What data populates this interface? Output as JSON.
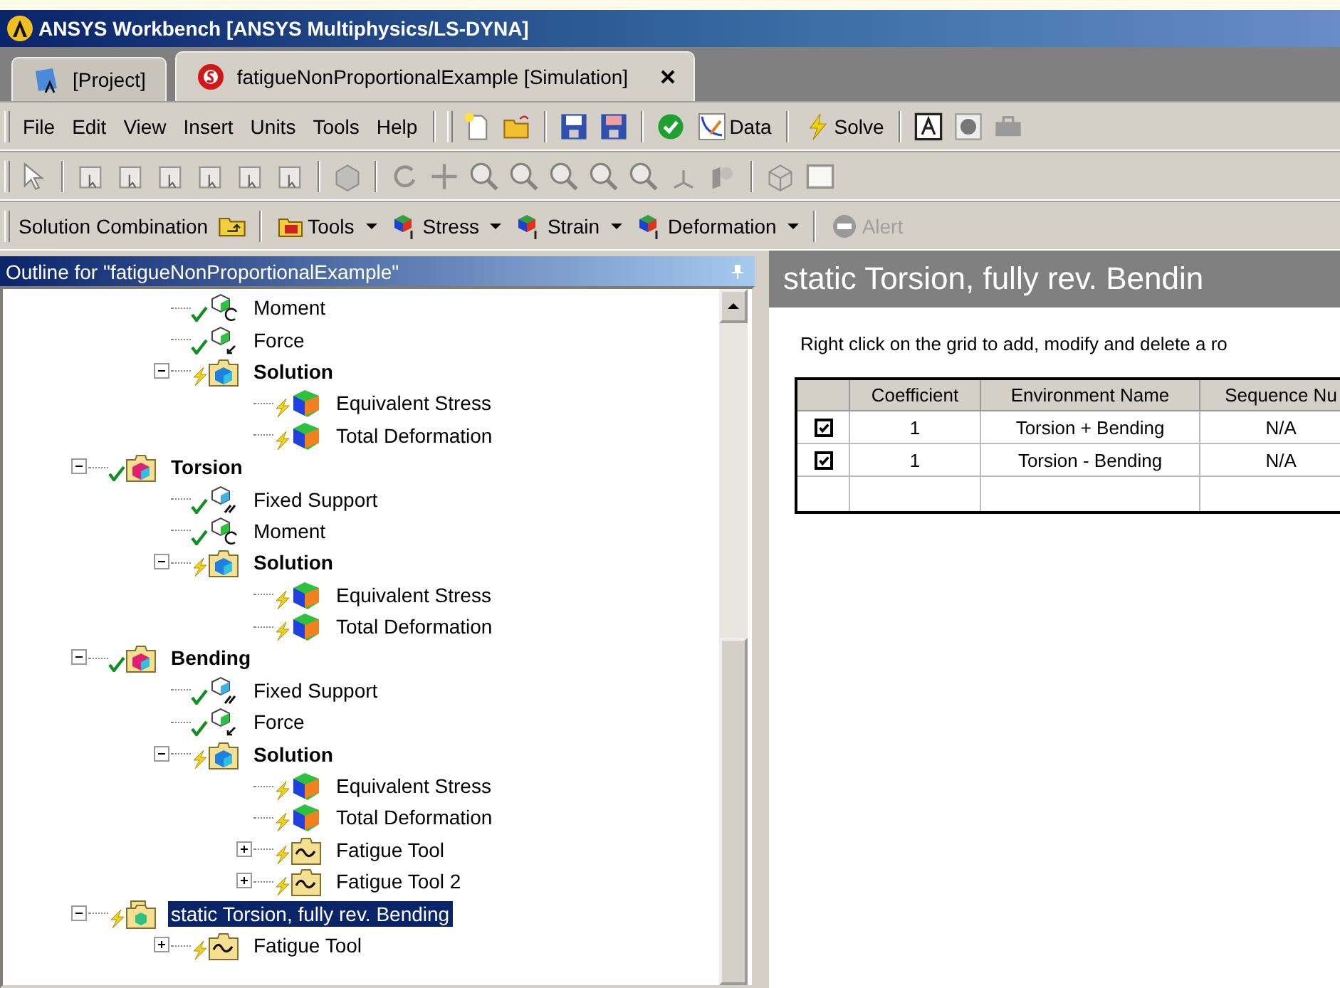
{
  "window": {
    "title": "ANSYS Workbench [ANSYS Multiphysics/LS-DYNA]"
  },
  "tabs": [
    {
      "label": "[Project]",
      "kind": "project",
      "selected": false
    },
    {
      "label": "fatigueNonProportionalExample [Simulation]",
      "kind": "simulation",
      "selected": true
    }
  ],
  "menu": [
    "File",
    "Edit",
    "View",
    "Insert",
    "Units",
    "Tools",
    "Help"
  ],
  "toolbar": {
    "data_button": "Data",
    "solve_button": "Solve"
  },
  "solution_toolbar": {
    "label": "Solution Combination",
    "buttons": [
      {
        "label": "Tools",
        "kind": "tools",
        "dropdown": true,
        "disabled": false
      },
      {
        "label": "Stress",
        "kind": "stress",
        "dropdown": true,
        "disabled": false
      },
      {
        "label": "Strain",
        "kind": "strain",
        "dropdown": true,
        "disabled": false
      },
      {
        "label": "Deformation",
        "kind": "deformation",
        "dropdown": true,
        "disabled": false
      },
      {
        "label": "Alert",
        "kind": "alert",
        "dropdown": false,
        "disabled": true
      }
    ]
  },
  "outline": {
    "title": "Outline for \"fatigueNonProportionalExample\"",
    "continued_items": [
      {
        "label": "Moment",
        "kind": "moment",
        "solved": true
      },
      {
        "label": "Force",
        "kind": "force",
        "solved": true
      },
      {
        "label": "Solution",
        "kind": "solution",
        "solved": false,
        "expanded": true,
        "children": [
          {
            "label": "Equivalent Stress",
            "kind": "result",
            "solved": false
          },
          {
            "label": "Total Deformation",
            "kind": "result",
            "solved": false
          }
        ]
      }
    ],
    "items": [
      {
        "label": "Torsion",
        "kind": "environment",
        "solved": true,
        "expanded": true,
        "children": [
          {
            "label": "Fixed Support",
            "kind": "support",
            "solved": true
          },
          {
            "label": "Moment",
            "kind": "moment",
            "solved": true
          },
          {
            "label": "Solution",
            "kind": "solution",
            "solved": false,
            "expanded": true,
            "children": [
              {
                "label": "Equivalent Stress",
                "kind": "result",
                "solved": false
              },
              {
                "label": "Total Deformation",
                "kind": "result",
                "solved": false
              }
            ]
          }
        ]
      },
      {
        "label": "Bending",
        "kind": "environment",
        "solved": true,
        "expanded": true,
        "children": [
          {
            "label": "Fixed Support",
            "kind": "support",
            "solved": true
          },
          {
            "label": "Force",
            "kind": "force",
            "solved": true
          },
          {
            "label": "Solution",
            "kind": "solution",
            "solved": false,
            "expanded": true,
            "children": [
              {
                "label": "Equivalent Stress",
                "kind": "result",
                "solved": false
              },
              {
                "label": "Total Deformation",
                "kind": "result",
                "solved": false
              },
              {
                "label": "Fatigue Tool",
                "kind": "fatigue_tool",
                "solved": false,
                "expanded": false
              },
              {
                "label": "Fatigue Tool 2",
                "kind": "fatigue_tool",
                "solved": false,
                "expanded": false
              }
            ]
          }
        ]
      },
      {
        "label": "static Torsion, fully rev. Bending",
        "kind": "combination",
        "solved": false,
        "expanded": true,
        "selected": true,
        "children": [
          {
            "label": "Fatigue Tool",
            "kind": "fatigue_tool",
            "solved": false,
            "expanded": false
          }
        ]
      }
    ]
  },
  "details": {
    "title": "static Torsion, fully rev. Bendin",
    "hint": "Right click on the grid to add, modify and delete a ro",
    "table": {
      "columns": [
        "Coefficient",
        "Environment Name",
        "Sequence Nu"
      ],
      "rows": [
        {
          "checked": true,
          "coefficient": "1",
          "environment": "Torsion + Bending",
          "sequence": "N/A"
        },
        {
          "checked": true,
          "coefficient": "1",
          "environment": "Torsion - Bending",
          "sequence": "N/A"
        }
      ]
    }
  }
}
